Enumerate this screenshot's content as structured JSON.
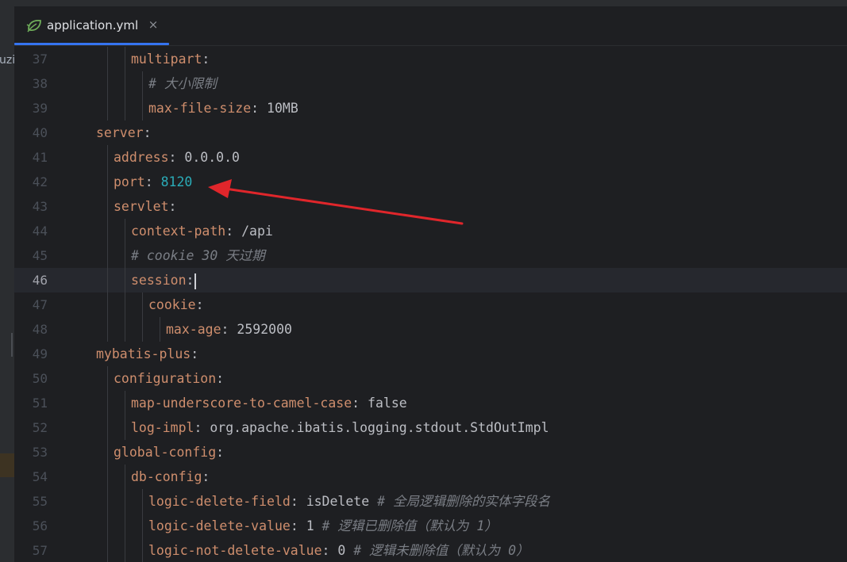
{
  "tab": {
    "filename": "application.yml",
    "close_symbol": "×",
    "icon": "spring-leaf-icon"
  },
  "left_panel": {
    "truncated_text": "uzi"
  },
  "editor": {
    "current_line": 46,
    "lines": [
      {
        "num": "37",
        "indent": 2,
        "key": "multipart",
        "sep": ":",
        "value": "",
        "comment": ""
      },
      {
        "num": "38",
        "indent": 3,
        "key": "",
        "sep": "",
        "value": "",
        "comment": "# 大小限制"
      },
      {
        "num": "39",
        "indent": 3,
        "key": "max-file-size",
        "sep": ": ",
        "value": "10MB",
        "comment": ""
      },
      {
        "num": "40",
        "indent": 0,
        "key": "server",
        "sep": ":",
        "value": "",
        "comment": ""
      },
      {
        "num": "41",
        "indent": 1,
        "key": "address",
        "sep": ": ",
        "value": "0.0.0.0",
        "comment": ""
      },
      {
        "num": "42",
        "indent": 1,
        "key": "port",
        "sep": ": ",
        "value": "8120",
        "value_type": "number",
        "comment": ""
      },
      {
        "num": "43",
        "indent": 1,
        "key": "servlet",
        "sep": ":",
        "value": "",
        "comment": ""
      },
      {
        "num": "44",
        "indent": 2,
        "key": "context-path",
        "sep": ": ",
        "value": "/api",
        "comment": ""
      },
      {
        "num": "45",
        "indent": 2,
        "key": "",
        "sep": "",
        "value": "",
        "comment": "# cookie 30 天过期"
      },
      {
        "num": "46",
        "indent": 2,
        "key": "session",
        "sep": ":",
        "value": "",
        "comment": "",
        "caret": true
      },
      {
        "num": "47",
        "indent": 3,
        "key": "cookie",
        "sep": ":",
        "value": "",
        "comment": ""
      },
      {
        "num": "48",
        "indent": 4,
        "key": "max-age",
        "sep": ": ",
        "value": "2592000",
        "comment": ""
      },
      {
        "num": "49",
        "indent": 0,
        "key": "mybatis-plus",
        "sep": ":",
        "value": "",
        "comment": ""
      },
      {
        "num": "50",
        "indent": 1,
        "key": "configuration",
        "sep": ":",
        "value": "",
        "comment": ""
      },
      {
        "num": "51",
        "indent": 2,
        "key": "map-underscore-to-camel-case",
        "sep": ": ",
        "value": "false",
        "comment": ""
      },
      {
        "num": "52",
        "indent": 2,
        "key": "log-impl",
        "sep": ": ",
        "value": "org.apache.ibatis.logging.stdout.StdOutImpl",
        "comment": ""
      },
      {
        "num": "53",
        "indent": 1,
        "key": "global-config",
        "sep": ":",
        "value": "",
        "comment": ""
      },
      {
        "num": "54",
        "indent": 2,
        "key": "db-config",
        "sep": ":",
        "value": "",
        "comment": ""
      },
      {
        "num": "55",
        "indent": 3,
        "key": "logic-delete-field",
        "sep": ": ",
        "value": "isDelete",
        "comment": " # 全局逻辑删除的实体字段名"
      },
      {
        "num": "56",
        "indent": 3,
        "key": "logic-delete-value",
        "sep": ": ",
        "value": "1",
        "comment": " # 逻辑已删除值（默认为 1）"
      },
      {
        "num": "57",
        "indent": 3,
        "key": "logic-not-delete-value",
        "sep": ": ",
        "value": "0",
        "comment": " # 逻辑未删除值（默认为 0）"
      }
    ]
  },
  "annotation": {
    "type": "red-arrow",
    "color": "#e0262b",
    "points_to_line": "42"
  },
  "colors": {
    "background": "#1e1f22",
    "key": "#cf8e6d",
    "number": "#2aacb8",
    "comment": "#7a7e85",
    "text": "#bcbec4",
    "tab_accent": "#3574f0"
  }
}
